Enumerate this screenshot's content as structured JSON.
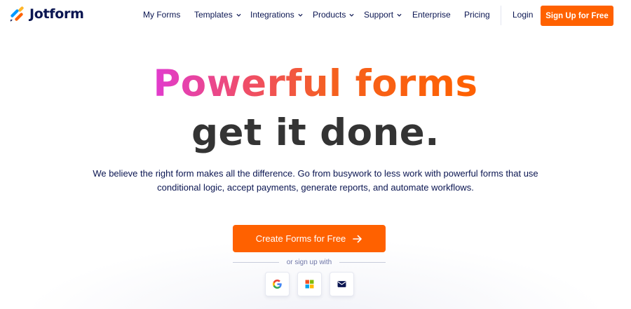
{
  "brand": {
    "name": "Jotform"
  },
  "nav": {
    "items": [
      {
        "label": "My Forms",
        "has_dropdown": false
      },
      {
        "label": "Templates",
        "has_dropdown": true
      },
      {
        "label": "Integrations",
        "has_dropdown": true
      },
      {
        "label": "Products",
        "has_dropdown": true
      },
      {
        "label": "Support",
        "has_dropdown": true
      },
      {
        "label": "Enterprise",
        "has_dropdown": false
      },
      {
        "label": "Pricing",
        "has_dropdown": false
      }
    ],
    "login_label": "Login",
    "signup_label": "Sign Up for Free"
  },
  "hero": {
    "title_line1": "Powerful forms",
    "title_line2": "get it done.",
    "description": "We believe the right form makes all the difference. Go from busywork to less work with powerful forms that use conditional logic, accept payments, generate reports, and automate workflows.",
    "cta_label": "Create Forms for Free",
    "or_sign_up_text": "or sign up with",
    "social_providers": [
      "google-icon",
      "microsoft-icon",
      "email-icon"
    ]
  },
  "colors": {
    "accent": "#ff6100",
    "navy": "#0a1551",
    "title_dark": "#343434",
    "gradient_start": "#e13bd0",
    "gradient_end": "#ff6100"
  }
}
